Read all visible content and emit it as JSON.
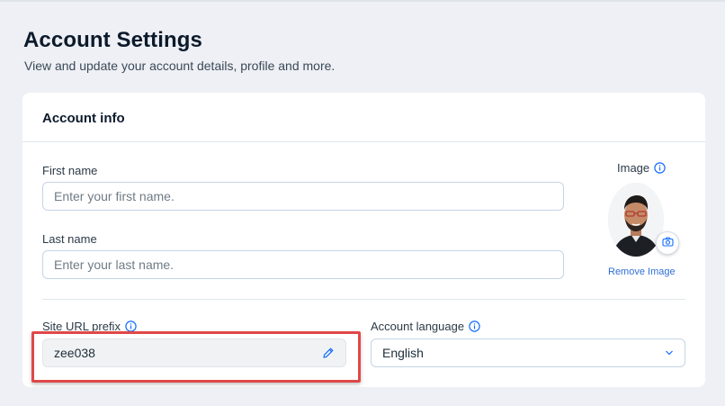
{
  "header": {
    "title": "Account Settings",
    "subtitle": "View and update your account details, profile and more."
  },
  "account_info": {
    "title": "Account info",
    "first_name": {
      "label": "First name",
      "placeholder": "Enter your first name.",
      "value": ""
    },
    "last_name": {
      "label": "Last name",
      "placeholder": "Enter your last name.",
      "value": ""
    },
    "image": {
      "label": "Image",
      "remove_label": "Remove Image"
    },
    "site_url_prefix": {
      "label": "Site URL prefix",
      "value": "zee038"
    },
    "account_language": {
      "label": "Account language",
      "value": "English"
    }
  },
  "icons": {
    "info": "info-icon",
    "edit": "pencil-icon",
    "camera": "camera-icon",
    "dropdown": "chevron-down-icon"
  },
  "colors": {
    "accent": "#116dff",
    "link": "#2f6fd6",
    "highlight": "#e04848",
    "background": "#eef0f5"
  }
}
